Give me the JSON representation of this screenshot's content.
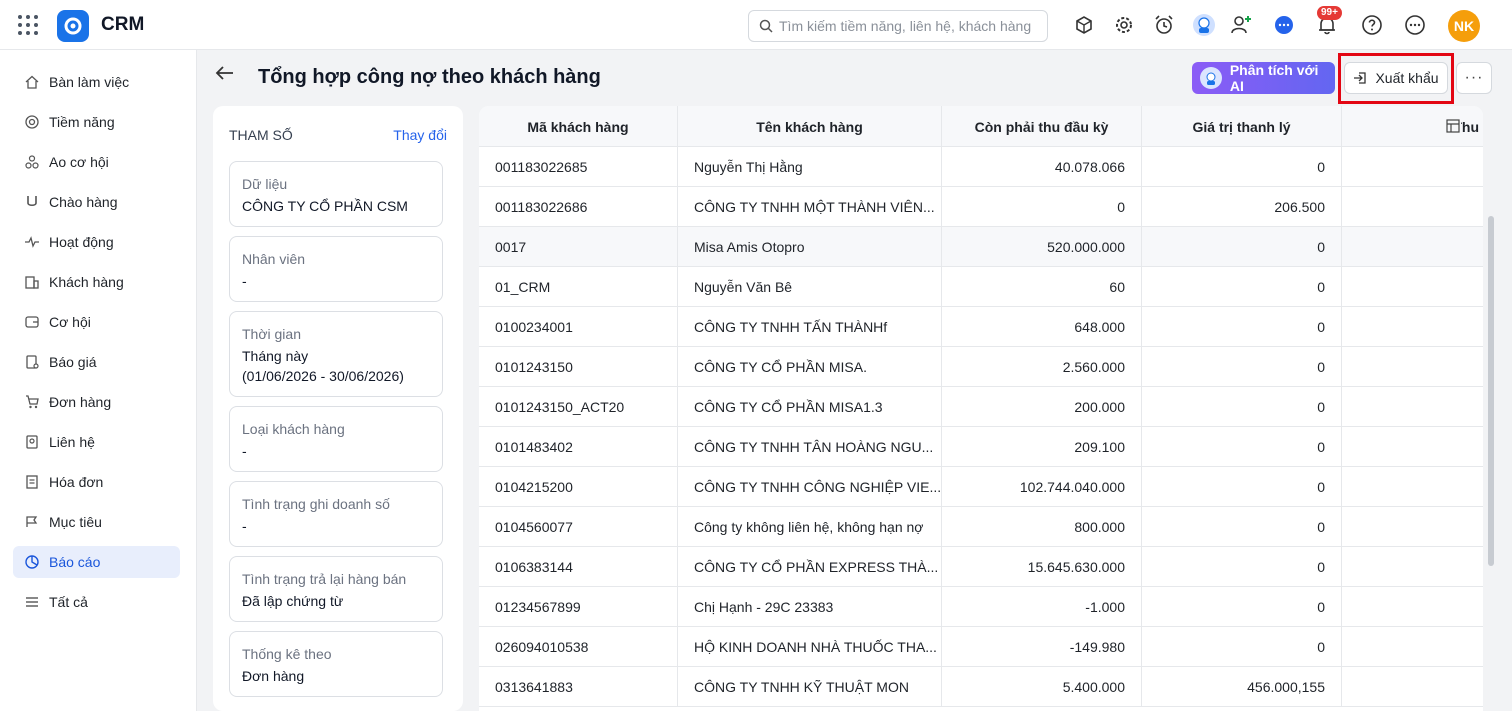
{
  "app": {
    "title": "CRM"
  },
  "search": {
    "placeholder": "Tìm kiếm tiềm năng, liên hệ, khách hàng"
  },
  "notifications": {
    "badge": "99+"
  },
  "user": {
    "initials": "NK"
  },
  "sidebar": {
    "items": [
      {
        "label": "Bàn làm việc",
        "icon": "home-icon"
      },
      {
        "label": "Tiềm năng",
        "icon": "target-icon"
      },
      {
        "label": "Ao cơ hội",
        "icon": "nodes-icon"
      },
      {
        "label": "Chào hàng",
        "icon": "magnet-icon"
      },
      {
        "label": "Hoạt động",
        "icon": "activity-icon"
      },
      {
        "label": "Khách hàng",
        "icon": "building-icon"
      },
      {
        "label": "Cơ hội",
        "icon": "wallet-icon"
      },
      {
        "label": "Báo giá",
        "icon": "quote-icon"
      },
      {
        "label": "Đơn hàng",
        "icon": "cart-icon"
      },
      {
        "label": "Liên hệ",
        "icon": "contact-icon"
      },
      {
        "label": "Hóa đơn",
        "icon": "invoice-icon"
      },
      {
        "label": "Mục tiêu",
        "icon": "goal-icon"
      },
      {
        "label": "Báo cáo",
        "icon": "chart-pie-icon",
        "active": true
      },
      {
        "label": "Tất cả",
        "icon": "menu-icon"
      }
    ]
  },
  "header": {
    "title": "Tổng hợp công nợ theo khách hàng",
    "ai_button": "Phân tích với AI",
    "export_button": "Xuất khẩu",
    "more_button": "···"
  },
  "params": {
    "title": "THAM SỐ",
    "change": "Thay đổi",
    "items": [
      {
        "label": "Dữ liệu",
        "value": "CÔNG TY CỔ PHẦN CSM"
      },
      {
        "label": "Nhân viên",
        "value": "-"
      },
      {
        "label": "Thời gian",
        "value": "Tháng này",
        "value2": "(01/06/2026 - 30/06/2026)"
      },
      {
        "label": "Loại khách hàng",
        "value": "-"
      },
      {
        "label": "Tình trạng ghi doanh số",
        "value": "-"
      },
      {
        "label": "Tình trạng trả lại hàng bán",
        "value": "Đã lập chứng từ"
      },
      {
        "label": "Thống kê theo",
        "value": "Đơn hàng"
      }
    ]
  },
  "table": {
    "headers": [
      "Mã khách hàng",
      "Tên khách hàng",
      "Còn phải thu đầu kỳ",
      "Giá trị thanh lý",
      "Thu"
    ],
    "rows": [
      [
        "001183022685",
        "Nguyễn Thị Hằng",
        "40.078.066",
        "0"
      ],
      [
        "001183022686",
        "CÔNG TY TNHH MỘT THÀNH VIÊN...",
        "0",
        "206.500"
      ],
      [
        "0017",
        "Misa Amis Otopro",
        "520.000.000",
        "0"
      ],
      [
        "01_CRM",
        "Nguyễn Văn Bê",
        "60",
        "0"
      ],
      [
        "0100234001",
        "CÔNG TY TNHH TẤN THÀNHf",
        "648.000",
        "0"
      ],
      [
        "0101243150",
        "CÔNG TY CỔ PHẦN MISA.",
        "2.560.000",
        "0"
      ],
      [
        "0101243150_ACT20",
        "CÔNG TY CỔ PHẦN MISA1.3",
        "200.000",
        "0"
      ],
      [
        "0101483402",
        "CÔNG TY TNHH TÂN HOÀNG NGU...",
        "209.100",
        "0"
      ],
      [
        "0104215200",
        "CÔNG TY TNHH CÔNG NGHIỆP VIE...",
        "102.744.040.000",
        "0"
      ],
      [
        "0104560077",
        "Công ty không liên hệ, không hạn nợ",
        "800.000",
        "0"
      ],
      [
        "0106383144",
        "CÔNG TY CỔ PHẦN EXPRESS THÀ...",
        "15.645.630.000",
        "0"
      ],
      [
        "01234567899",
        "Chị Hạnh - 29C 23383",
        "-1.000",
        "0"
      ],
      [
        "026094010538",
        "HỘ KINH DOANH NHÀ THUỐC THA...",
        "-149.980",
        "0"
      ],
      [
        "0313641883",
        "CÔNG TY TNHH KỸ THUẬT MON",
        "5.400.000",
        "456.000,155"
      ]
    ]
  }
}
